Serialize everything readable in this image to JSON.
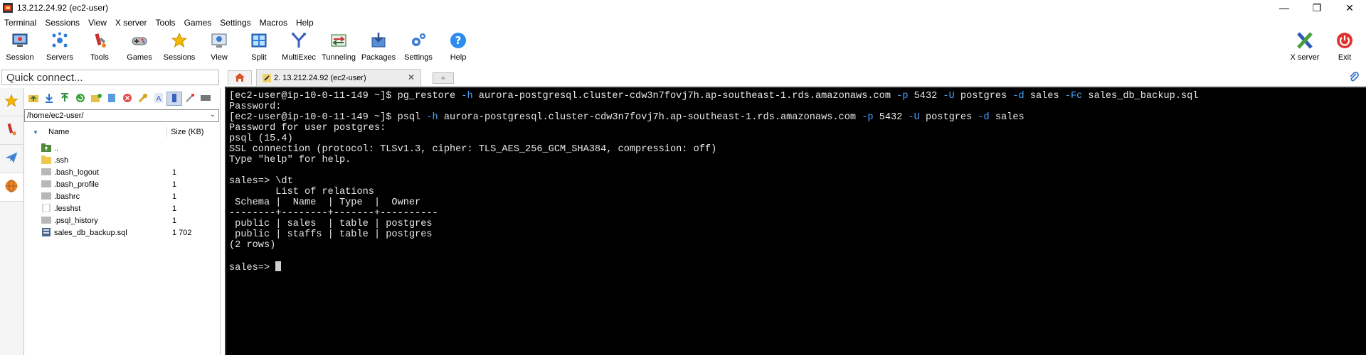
{
  "window": {
    "title": "13.212.24.92 (ec2-user)",
    "controls": {
      "minimize": "—",
      "restore": "❐",
      "close": "✕"
    }
  },
  "menu": [
    "Terminal",
    "Sessions",
    "View",
    "X server",
    "Tools",
    "Games",
    "Settings",
    "Macros",
    "Help"
  ],
  "toolbar": {
    "left": [
      {
        "label": "Session",
        "icon": "session-icon"
      },
      {
        "label": "Servers",
        "icon": "servers-icon"
      },
      {
        "label": "Tools",
        "icon": "tools-icon"
      },
      {
        "label": "Games",
        "icon": "games-icon"
      },
      {
        "label": "Sessions",
        "icon": "star-icon"
      },
      {
        "label": "View",
        "icon": "view-icon"
      },
      {
        "label": "Split",
        "icon": "split-icon"
      },
      {
        "label": "MultiExec",
        "icon": "multiexec-icon"
      },
      {
        "label": "Tunneling",
        "icon": "tunneling-icon"
      },
      {
        "label": "Packages",
        "icon": "packages-icon"
      },
      {
        "label": "Settings",
        "icon": "settings-icon"
      },
      {
        "label": "Help",
        "icon": "help-icon"
      }
    ],
    "right": [
      {
        "label": "X server",
        "icon": "xserver-icon"
      },
      {
        "label": "Exit",
        "icon": "power-icon"
      }
    ]
  },
  "quick_connect": {
    "placeholder": "Quick connect..."
  },
  "tabs": {
    "home_icon": "home-icon",
    "session_tab": {
      "label": "2. 13.212.24.92 (ec2-user)",
      "close": "✕"
    },
    "new_tab": "+"
  },
  "sftp": {
    "path": "/home/ec2-user/",
    "columns": {
      "name": "Name",
      "size": "Size (KB)"
    },
    "files": [
      {
        "name": "..",
        "size": "",
        "icon": "parent-folder-icon"
      },
      {
        "name": ".ssh",
        "size": "",
        "icon": "folder-icon"
      },
      {
        "name": ".bash_logout",
        "size": "1",
        "icon": "file-icon"
      },
      {
        "name": ".bash_profile",
        "size": "1",
        "icon": "file-icon"
      },
      {
        "name": ".bashrc",
        "size": "1",
        "icon": "file-icon"
      },
      {
        "name": ".lesshst",
        "size": "1",
        "icon": "text-file-icon"
      },
      {
        "name": ".psql_history",
        "size": "1",
        "icon": "file-icon"
      },
      {
        "name": "sales_db_backup.sql",
        "size": "1 702",
        "icon": "sql-file-icon"
      }
    ]
  },
  "terminal": {
    "lines": [
      [
        [
          "w",
          "[ec2-user@ip-10-0-11-149 ~]$ pg_restore "
        ],
        [
          "f",
          "-h"
        ],
        [
          "w",
          " aurora-postgresql.cluster-cdw3n7fovj7h.ap-southeast-1.rds.amazonaws.com "
        ],
        [
          "f",
          "-p"
        ],
        [
          "w",
          " 5432 "
        ],
        [
          "f",
          "-U"
        ],
        [
          "w",
          " postgres "
        ],
        [
          "f",
          "-d"
        ],
        [
          "w",
          " sales "
        ],
        [
          "f",
          "-Fc"
        ],
        [
          "w",
          " sales_db_backup.sql"
        ]
      ],
      [
        [
          "w",
          "Password:"
        ]
      ],
      [
        [
          "w",
          "[ec2-user@ip-10-0-11-149 ~]$ psql "
        ],
        [
          "f",
          "-h"
        ],
        [
          "w",
          " aurora-postgresql.cluster-cdw3n7fovj7h.ap-southeast-1.rds.amazonaws.com "
        ],
        [
          "f",
          "-p"
        ],
        [
          "w",
          " 5432 "
        ],
        [
          "f",
          "-U"
        ],
        [
          "w",
          " postgres "
        ],
        [
          "f",
          "-d"
        ],
        [
          "w",
          " sales"
        ]
      ],
      [
        [
          "w",
          "Password for user postgres:"
        ]
      ],
      [
        [
          "w",
          "psql (15.4)"
        ]
      ],
      [
        [
          "w",
          "SSL connection (protocol: TLSv1.3, cipher: TLS_AES_256_GCM_SHA384, compression: off)"
        ]
      ],
      [
        [
          "w",
          "Type \"help\" for help."
        ]
      ],
      [
        [
          "w",
          ""
        ]
      ],
      [
        [
          "w",
          "sales=> \\dt"
        ]
      ],
      [
        [
          "w",
          "        List of relations"
        ]
      ],
      [
        [
          "w",
          " Schema |  Name  | Type  |  Owner"
        ]
      ],
      [
        [
          "w",
          "--------+--------+-------+----------"
        ]
      ],
      [
        [
          "w",
          " public | sales  | table | postgres"
        ]
      ],
      [
        [
          "w",
          " public | staffs | table | postgres"
        ]
      ],
      [
        [
          "w",
          "(2 rows)"
        ]
      ],
      [
        [
          "w",
          ""
        ]
      ],
      [
        [
          "w",
          "sales=> "
        ]
      ]
    ]
  },
  "colors": {
    "terminal_bg": "#000000",
    "terminal_fg": "#e8e8e8",
    "flag": "#4aa0ff"
  }
}
